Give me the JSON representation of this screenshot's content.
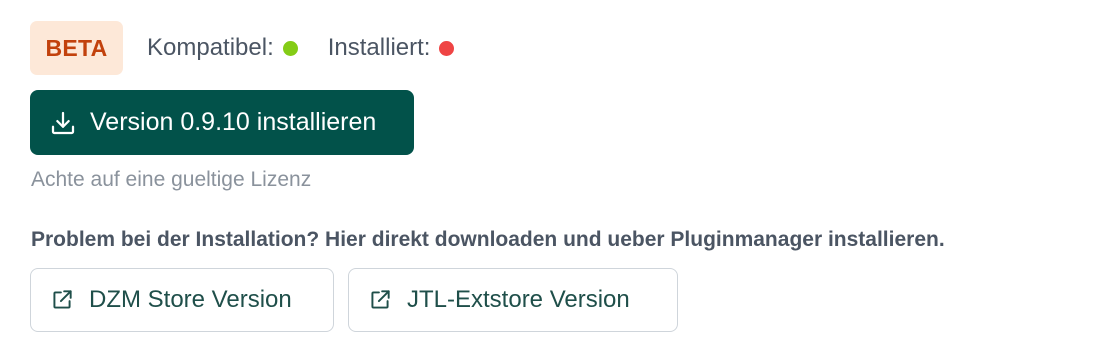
{
  "status": {
    "badge": "BETA",
    "compatible_label": "Kompatibel:",
    "compatible_color": "#84cc16",
    "installed_label": "Installiert:",
    "installed_color": "#ef4444"
  },
  "install": {
    "label": "Version 0.9.10 installieren",
    "icon": "download-icon"
  },
  "hint": "Achte auf eine gueltige Lizenz",
  "problem_text": "Problem bei der Installation? Hier direkt downloaden und ueber Pluginmanager installieren.",
  "downloads": [
    {
      "label": "DZM Store Version",
      "icon": "external-link-icon"
    },
    {
      "label": "JTL-Extstore Version",
      "icon": "external-link-icon"
    }
  ],
  "colors": {
    "primary": "#02524a",
    "badge_bg": "#fde8d8",
    "badge_text": "#c2410c"
  }
}
